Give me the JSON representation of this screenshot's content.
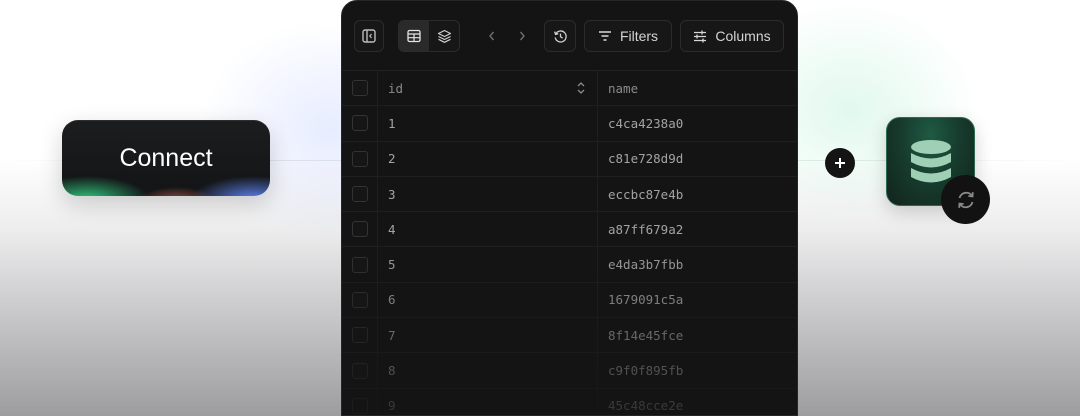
{
  "connect": {
    "label": "Connect"
  },
  "toolbar": {
    "filters_label": "Filters",
    "columns_label": "Columns",
    "icons": {
      "sidebar_toggle": "sidebar-panel-icon",
      "table_view": "table-grid-icon",
      "schema_view": "layers-icon",
      "prev": "chevron-left-icon",
      "next": "chevron-right-icon",
      "history": "history-icon",
      "filters": "filter-icon",
      "columns": "sliders-icon"
    }
  },
  "table": {
    "columns": [
      "id",
      "name"
    ],
    "rows": [
      {
        "id": "1",
        "name": "c4ca4238a0"
      },
      {
        "id": "2",
        "name": "c81e728d9d"
      },
      {
        "id": "3",
        "name": "eccbc87e4b"
      },
      {
        "id": "4",
        "name": "a87ff679a2"
      },
      {
        "id": "5",
        "name": "e4da3b7fbb"
      },
      {
        "id": "6",
        "name": "1679091c5a"
      },
      {
        "id": "7",
        "name": "8f14e45fce"
      },
      {
        "id": "8",
        "name": "c9f0f895fb"
      },
      {
        "id": "9",
        "name": "45c48cce2e"
      }
    ]
  },
  "colors": {
    "panel_bg": "#141414",
    "accent_green": "#34d385",
    "accent_blue": "#648cff"
  },
  "integration": {
    "icons": [
      "plus-icon",
      "database-icon",
      "sync-icon"
    ]
  }
}
